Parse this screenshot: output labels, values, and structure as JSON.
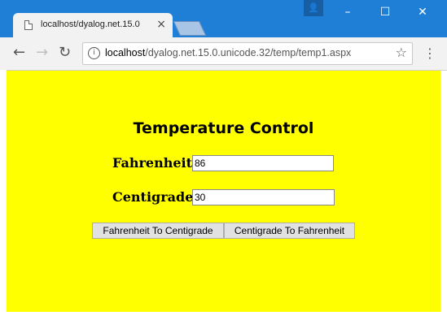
{
  "browser": {
    "tab_title": "localhost/dyalog.net.15.0",
    "tab_close": "×",
    "window_controls": {
      "minimize": "–",
      "maximize": "☐",
      "close": "✕"
    },
    "profile_icon": "👤",
    "nav": {
      "back": "←",
      "forward": "→",
      "reload": "↻"
    },
    "address": {
      "host": "localhost",
      "path": "/dyalog.net.15.0.unicode.32/temp/temp1.aspx",
      "info_glyph": "i"
    },
    "bookmark_glyph": "☆",
    "menu_glyph": "⋮"
  },
  "page": {
    "heading": "Temperature Control",
    "fahrenheit_label": "Fahrenheit:",
    "fahrenheit_value": "86",
    "centigrade_label": "Centigrade:",
    "centigrade_value": "30",
    "button_f2c": "Fahrenheit To Centigrade",
    "button_c2f": "Centigrade To Fahrenheit",
    "background_color": "#ffff00"
  },
  "colors": {
    "titlebar": "#1f7fd6",
    "toolbar": "#f2f2f2"
  }
}
